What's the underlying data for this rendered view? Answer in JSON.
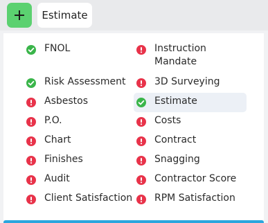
{
  "toolbar": {
    "add_symbol": "+",
    "tab_label": "Estimate"
  },
  "colors": {
    "ok": "#3ab54a",
    "alert": "#e8334a",
    "add": "#5bd170",
    "accent": "#2ba6de"
  },
  "left_items": [
    {
      "label": "FNOL",
      "status": "ok"
    },
    {
      "label": "Risk Assessment",
      "status": "ok"
    },
    {
      "label": "Asbestos",
      "status": "alert"
    },
    {
      "label": "P.O.",
      "status": "alert"
    },
    {
      "label": "Chart",
      "status": "alert"
    },
    {
      "label": "Finishes",
      "status": "alert"
    },
    {
      "label": "Audit",
      "status": "alert"
    },
    {
      "label": "Client Satisfaction",
      "status": "alert"
    }
  ],
  "right_items": [
    {
      "label": "Instruction Mandate",
      "status": "alert"
    },
    {
      "label": "3D Surveying",
      "status": "alert"
    },
    {
      "label": "Estimate",
      "status": "ok",
      "selected": true
    },
    {
      "label": "Costs",
      "status": "alert"
    },
    {
      "label": "Contract",
      "status": "alert"
    },
    {
      "label": "Snagging",
      "status": "alert"
    },
    {
      "label": "Contractor Score",
      "status": "alert"
    },
    {
      "label": "RPM Satisfaction",
      "status": "alert"
    }
  ]
}
